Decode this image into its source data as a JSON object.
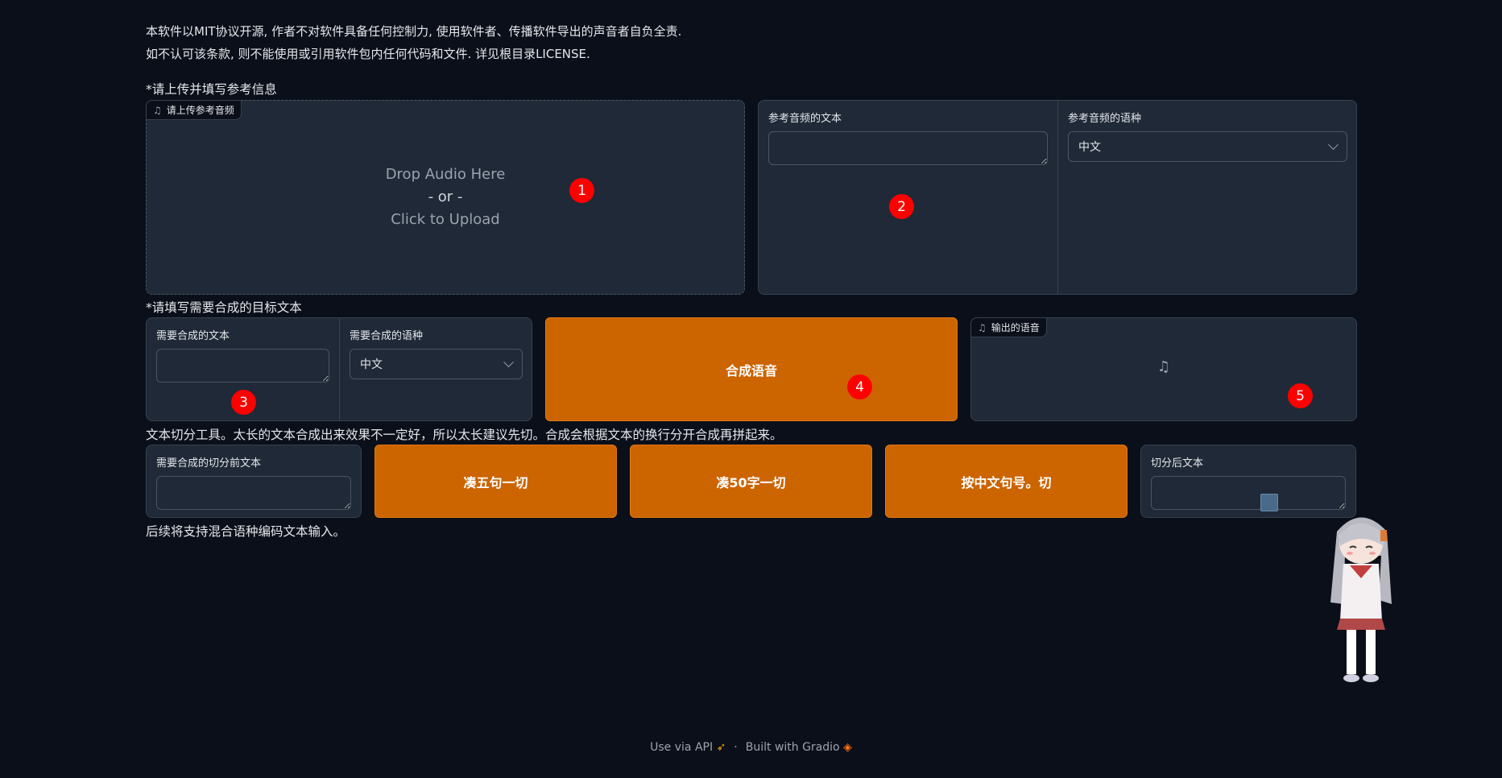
{
  "notice": {
    "line1": "本软件以MIT协议开源, 作者不对软件具备任何控制力, 使用软件者、传播软件导出的声音者自负全责.",
    "line2": "如不认可该条款, 则不能使用或引用软件包内任何代码和文件. 详见根目录LICENSE."
  },
  "reference": {
    "section_label": "*请上传并填写参考信息",
    "upload": {
      "tag_label": "请上传参考音频",
      "drop_text": "Drop Audio Here",
      "or_text": "- or -",
      "click_text": "Click to Upload"
    },
    "ref_text": {
      "label": "参考音频的文本",
      "value": ""
    },
    "ref_lang": {
      "label": "参考音频的语种",
      "value": "中文"
    }
  },
  "target": {
    "section_label": "*请填写需要合成的目标文本",
    "text": {
      "label": "需要合成的文本",
      "value": ""
    },
    "lang": {
      "label": "需要合成的语种",
      "value": "中文"
    },
    "synth_button": "合成语音",
    "output": {
      "tag_label": "输出的语音"
    }
  },
  "split_tool": {
    "description": "文本切分工具。太长的文本合成出来效果不一定好，所以太长建议先切。合成会根据文本的换行分开合成再拼起来。",
    "input": {
      "label": "需要合成的切分前文本",
      "value": ""
    },
    "btn_five": "凑五句一切",
    "btn_fifty": "凑50字一切",
    "btn_period": "按中文句号。切",
    "output": {
      "label": "切分后文本",
      "value": ""
    },
    "footnote": "后续将支持混合语种编码文本输入。"
  },
  "markers": [
    "1",
    "2",
    "3",
    "4",
    "5"
  ],
  "footer": {
    "api": "Use via API",
    "separator": "·",
    "built": "Built with Gradio"
  },
  "colors": {
    "background": "#0b0f19",
    "panel": "#1f2937",
    "accent": "#cc6400",
    "marker": "#ff0000"
  }
}
